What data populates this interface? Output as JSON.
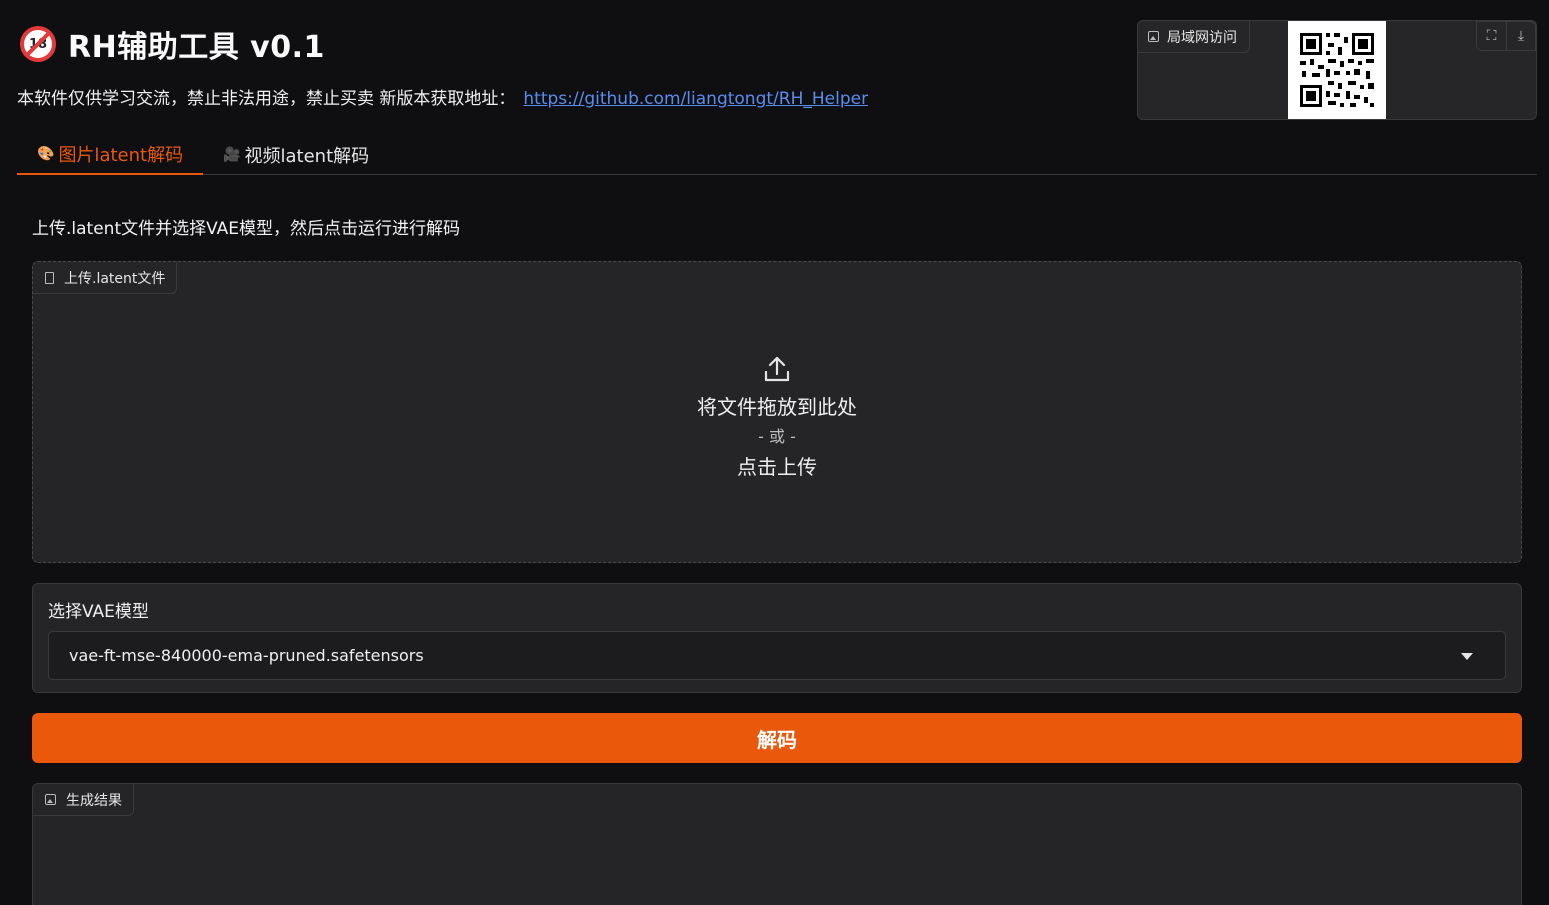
{
  "header": {
    "title": "RH辅助工具 v0.1",
    "title_icon": "no-under-18-icon",
    "disclaimer": "本软件仅供学习交流，禁止非法用途，禁止买卖 新版本获取地址：",
    "link_text": "https://github.com/liangtongt/RH_Helper"
  },
  "qr_panel": {
    "label": "局域网访问",
    "fullscreen_icon": "fullscreen-icon",
    "download_icon": "download-icon"
  },
  "tabs": [
    {
      "label": "图片latent解码",
      "icon": "palette-icon",
      "active": true
    },
    {
      "label": "视频latent解码",
      "icon": "film-projector-icon",
      "active": false
    }
  ],
  "main": {
    "instruction": "上传.latent文件并选择VAE模型，然后点击运行进行解码",
    "upload": {
      "label": "上传.latent文件",
      "drop_text": "将文件拖放到此处",
      "or_text": "- 或 -",
      "click_text": "点击上传"
    },
    "vae": {
      "label": "选择VAE模型",
      "selected": "vae-ft-mse-840000-ema-pruned.safetensors"
    },
    "decode_button": "解码",
    "result_label": "生成结果"
  },
  "colors": {
    "accent": "#ea580c",
    "link": "#5b8def",
    "background": "#0f0f11",
    "panel": "#252527"
  }
}
